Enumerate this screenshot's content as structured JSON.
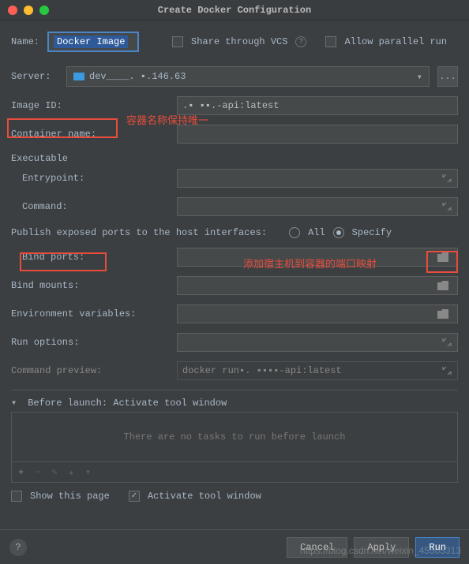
{
  "title": "Create Docker Configuration",
  "name": {
    "label": "Name:",
    "value": "Docker Image"
  },
  "shareVCS": "Share through VCS",
  "allowParallel": "Allow parallel run",
  "server": {
    "label": "Server:",
    "value": "dev____. ▪.146.63",
    "more": "..."
  },
  "imageId": {
    "label": "Image ID:",
    "value": ".▪ ▪▪.-api:latest"
  },
  "containerName": {
    "label": "Container name:"
  },
  "annotation1": "容器名称保持唯一",
  "executable": {
    "title": "Executable",
    "entrypoint": "Entrypoint:",
    "command": "Command:"
  },
  "publishPorts": "Publish exposed ports to the host interfaces:",
  "radioAll": "All",
  "radioSpecify": "Specify",
  "bindPorts": "Bind ports:",
  "annotation2": "添加宿主机到容器的端口映射",
  "bindMounts": "Bind mounts:",
  "envVars": "Environment variables:",
  "runOptions": "Run options:",
  "commandPreview": {
    "label": "Command preview:",
    "value": "docker run▪. ▪▪▪▪-api:latest"
  },
  "beforeLaunch": {
    "title": "Before launch: Activate tool window",
    "empty": "There are no tasks to run before launch"
  },
  "showThisPage": "Show this page",
  "activateToolWindow": "Activate tool window",
  "buttons": {
    "cancel": "Cancel",
    "apply": "Apply",
    "run": "Run"
  },
  "watermark": "https://blog.csdn.net/weixin_45505313"
}
